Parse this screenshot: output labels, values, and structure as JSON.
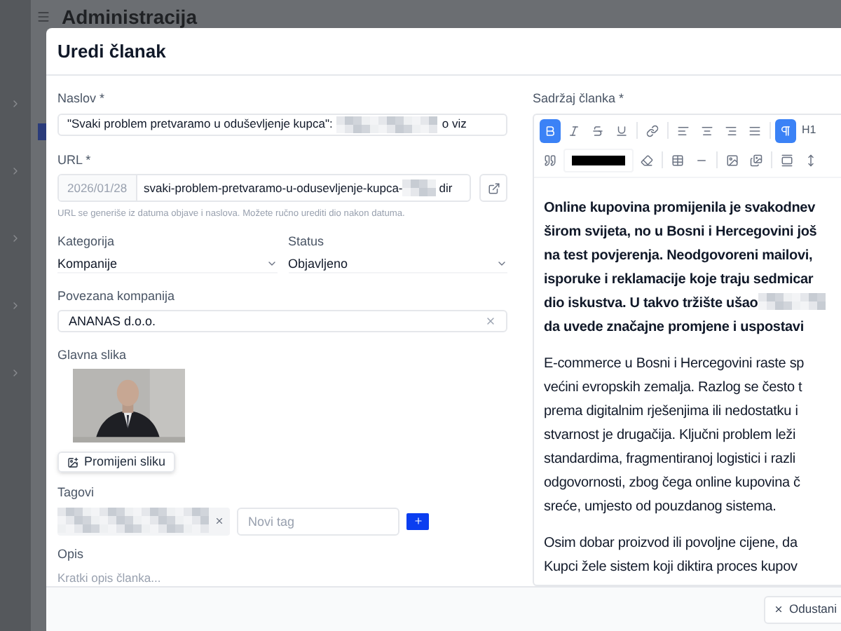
{
  "app": {
    "title": "Administracija"
  },
  "dialog": {
    "title": "Uredi članak",
    "title_field": {
      "label": "Naslov *",
      "value_start": "\"Svaki problem pretvaramo u oduševljenje kupca\":",
      "value_end": "o viz"
    },
    "url_field": {
      "label": "URL *",
      "prefix": "2026/01/28",
      "value_start": "svaki-problem-pretvaramo-u-odusevljenje-kupca-",
      "value_end": "dir",
      "hint": "URL se generiše iz datuma objave i naslova. Možete ručno urediti dio nakon datuma."
    },
    "category": {
      "label": "Kategorija",
      "value": "Kompanije"
    },
    "status": {
      "label": "Status",
      "value": "Objavljeno"
    },
    "company": {
      "label": "Povezana kompanija",
      "value": "ANANAS d.o.o."
    },
    "main_image": {
      "label": "Glavna slika",
      "kind": "picture",
      "button": "Promijeni sliku"
    },
    "tags": {
      "label": "Tagovi",
      "items": [
        {
          "kind": "redacted"
        }
      ],
      "placeholder": "Novi tag"
    },
    "description": {
      "label": "Opis",
      "placeholder": "Kratki opis članka..."
    },
    "content": {
      "label": "Sadržaj članka *",
      "toolbar": [
        [
          {
            "kind": "icon",
            "selected": true
          },
          {
            "kind": "icon",
            "selected": false
          },
          {
            "kind": "icon",
            "selected": false
          },
          {
            "kind": "icon",
            "selected": false
          },
          {
            "kind": "separator"
          },
          {
            "kind": "icon",
            "selected": false
          },
          {
            "kind": "separator"
          },
          {
            "kind": "icon",
            "selected": false
          },
          {
            "kind": "icon",
            "selected": false
          },
          {
            "kind": "icon",
            "selected": false
          },
          {
            "kind": "icon",
            "selected": false
          },
          {
            "kind": "separator"
          },
          {
            "kind": "icon",
            "selected": true
          },
          {
            "kind": "text",
            "label": "H1",
            "selected": false
          }
        ],
        [
          {
            "kind": "icon",
            "selected": false
          },
          {
            "kind": "color",
            "color": "#000000"
          },
          {
            "kind": "icon",
            "selected": false
          },
          {
            "kind": "separator"
          },
          {
            "kind": "icon",
            "selected": false
          },
          {
            "kind": "icon",
            "selected": false
          },
          {
            "kind": "separator"
          },
          {
            "kind": "icon",
            "selected": false
          },
          {
            "kind": "icon",
            "selected": false
          },
          {
            "kind": "separator"
          },
          {
            "kind": "icon",
            "selected": false
          },
          {
            "kind": "icon",
            "selected": false
          }
        ]
      ],
      "paragraphs": [
        {
          "kind": "bold",
          "lines": [
            {
              "kind": "plain",
              "text": "Online kupovina promijenila je svakodnev"
            },
            {
              "kind": "plain",
              "text": "širom svijeta, no u Bosni i Hercegovini još"
            },
            {
              "kind": "plain",
              "text": "na test povjerenja. Neodgovoreni mailovi,"
            },
            {
              "kind": "plain",
              "text": "isporuke i reklamacije koje traju sedmicar"
            },
            {
              "kind": "redacted_tail",
              "text": "dio iskustva. U takvo tržište ušao"
            },
            {
              "kind": "plain",
              "text": "da uvede značajne promjene i uspostavi"
            }
          ]
        },
        {
          "kind": "normal",
          "lines": [
            {
              "kind": "plain",
              "text": "E-commerce u Bosni i Hercegovini raste sp"
            },
            {
              "kind": "plain",
              "text": "većini evropskih zemalja. Razlog se često t"
            },
            {
              "kind": "plain",
              "text": "prema digitalnim rješenjima ili nedostatku i"
            },
            {
              "kind": "plain",
              "text": "stvarnost je drugačija. Ključni problem leži"
            },
            {
              "kind": "plain",
              "text": "standardima, fragmentiranoj logistici i razli"
            },
            {
              "kind": "plain",
              "text": "odgovornosti, zbog čega online kupovina č"
            },
            {
              "kind": "plain",
              "text": "sreće, umjesto od pouzdanog sistema."
            }
          ]
        },
        {
          "kind": "normal",
          "lines": [
            {
              "kind": "plain",
              "text": "Osim dobar proizvod ili povoljne cijene, da"
            },
            {
              "kind": "plain",
              "text": "Kupci žele sistem koji diktira proces kupov"
            }
          ]
        }
      ]
    },
    "footer": {
      "cancel": "Odustani"
    }
  }
}
